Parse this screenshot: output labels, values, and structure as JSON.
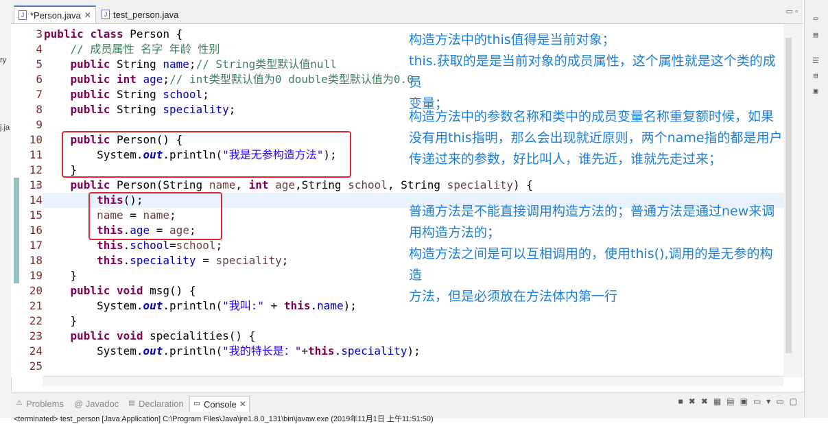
{
  "tabs": [
    {
      "label": "*Person.java",
      "active": true,
      "icon": "java-file-icon"
    },
    {
      "label": "test_person.java",
      "active": false,
      "icon": "java-file-icon"
    }
  ],
  "left_fragments": [
    "ry",
    "j.ja"
  ],
  "editor": {
    "lines": [
      {
        "n": "3",
        "html": "<span class=\"kw\">public</span> <span class=\"kw\">class</span> Person {"
      },
      {
        "n": "4",
        "html": "    <span class=\"cm\">// 成员属性 名字 年龄 性别</span>"
      },
      {
        "n": "5",
        "html": "    <span class=\"kw\">public</span> String <span class=\"fld\">name</span>;<span class=\"cm\">// String类型默认值null</span>"
      },
      {
        "n": "6",
        "html": "    <span class=\"kw\">public</span> <span class=\"kw\">int</span> <span class=\"fld\">age</span>;<span class=\"cm\">// int类型默认值为0 double类型默认值为0.0</span>"
      },
      {
        "n": "7",
        "html": "    <span class=\"kw\">public</span> String <span class=\"fld\">school</span>;"
      },
      {
        "n": "8",
        "html": "    <span class=\"kw\">public</span> String <span class=\"fld\">speciality</span>;"
      },
      {
        "n": "9",
        "html": ""
      },
      {
        "n": "10",
        "html": "    <span class=\"kw\">public</span> Person() {"
      },
      {
        "n": "11",
        "html": "        System.<span class=\"st\">out</span>.println(<span class=\"str\">\"我是无参构造方法\"</span>);"
      },
      {
        "n": "12",
        "html": "    }"
      },
      {
        "n": "13",
        "html": "    <span class=\"kw\">public</span> Person(String <span class=\"var\">name</span>, <span class=\"kw\">int</span> <span class=\"var\">age</span>,String <span class=\"var\">school</span>, String <span class=\"var\">speciality</span>) {"
      },
      {
        "n": "14",
        "html": "        <span class=\"kw\">this</span>();"
      },
      {
        "n": "15",
        "html": "        <span class=\"var\">name</span> = <span class=\"var\">name</span>;"
      },
      {
        "n": "16",
        "html": "        <span class=\"kw\">this</span>.<span class=\"fld\">age</span> = <span class=\"var\">age</span>;"
      },
      {
        "n": "17",
        "html": "        <span class=\"kw\">this</span>.<span class=\"fld\">school</span>=<span class=\"var\">school</span>;"
      },
      {
        "n": "18",
        "html": "        <span class=\"kw\">this</span>.<span class=\"fld\">speciality</span> = <span class=\"var\">speciality</span>;"
      },
      {
        "n": "19",
        "html": "    }"
      },
      {
        "n": "20",
        "html": "    <span class=\"kw\">public</span> <span class=\"kw\">void</span> msg() {"
      },
      {
        "n": "21",
        "html": "        System.<span class=\"st\">out</span>.println(<span class=\"str\">\"我叫:\"</span> + <span class=\"kw\">this</span>.<span class=\"fld\">name</span>);"
      },
      {
        "n": "22",
        "html": "    }"
      },
      {
        "n": "23",
        "html": "    <span class=\"kw\">public</span> <span class=\"kw\">void</span> specialities() {"
      },
      {
        "n": "24",
        "html": "        System.<span class=\"st\">out</span>.println(<span class=\"str\">\"我的特长是：\"</span>+<span class=\"kw\">this</span>.<span class=\"fld\">speciality</span>);"
      },
      {
        "n": "25",
        "html": ""
      }
    ]
  },
  "notes": {
    "n1": [
      "构造方法中的this值得是当前对象；",
      "this.获取的是是当前对象的成员属性，这个属性就是这个类的成员",
      "变量；"
    ],
    "n2": [
      "构造方法中的参数名称和类中的成员变量名称重复额时候，如果",
      "没有用this指明，那么会出现就近原则，两个name指的都是用户",
      "传递过来的参数，好比叫人，谁先近，谁就先走过来；"
    ],
    "n3": [
      "普通方法是不能直接调用构造方法的；普通方法是通过new来调",
      "用构造方法的；",
      "构造方法之间是可以互相调用的，使用this(),调用的是无参的构造",
      "方法，但是必须放在方法体内第一行"
    ]
  },
  "bottom": {
    "tabs": [
      {
        "label": "Problems",
        "active": false
      },
      {
        "label": "@ Javadoc",
        "active": false
      },
      {
        "label": "Declaration",
        "active": false
      },
      {
        "label": "Console",
        "active": true
      }
    ],
    "status": "<terminated> test_person [Java Application] C:\\Program Files\\Java\\jre1.8.0_131\\bin\\javaw.exe (2019年11月1日 上午11:51:50)"
  },
  "colors": {
    "keyword": "#7f0055",
    "field": "#0000c0",
    "comment": "#3f7f5f",
    "note": "#1e7fd6",
    "highlight_box": "#e0282e"
  }
}
